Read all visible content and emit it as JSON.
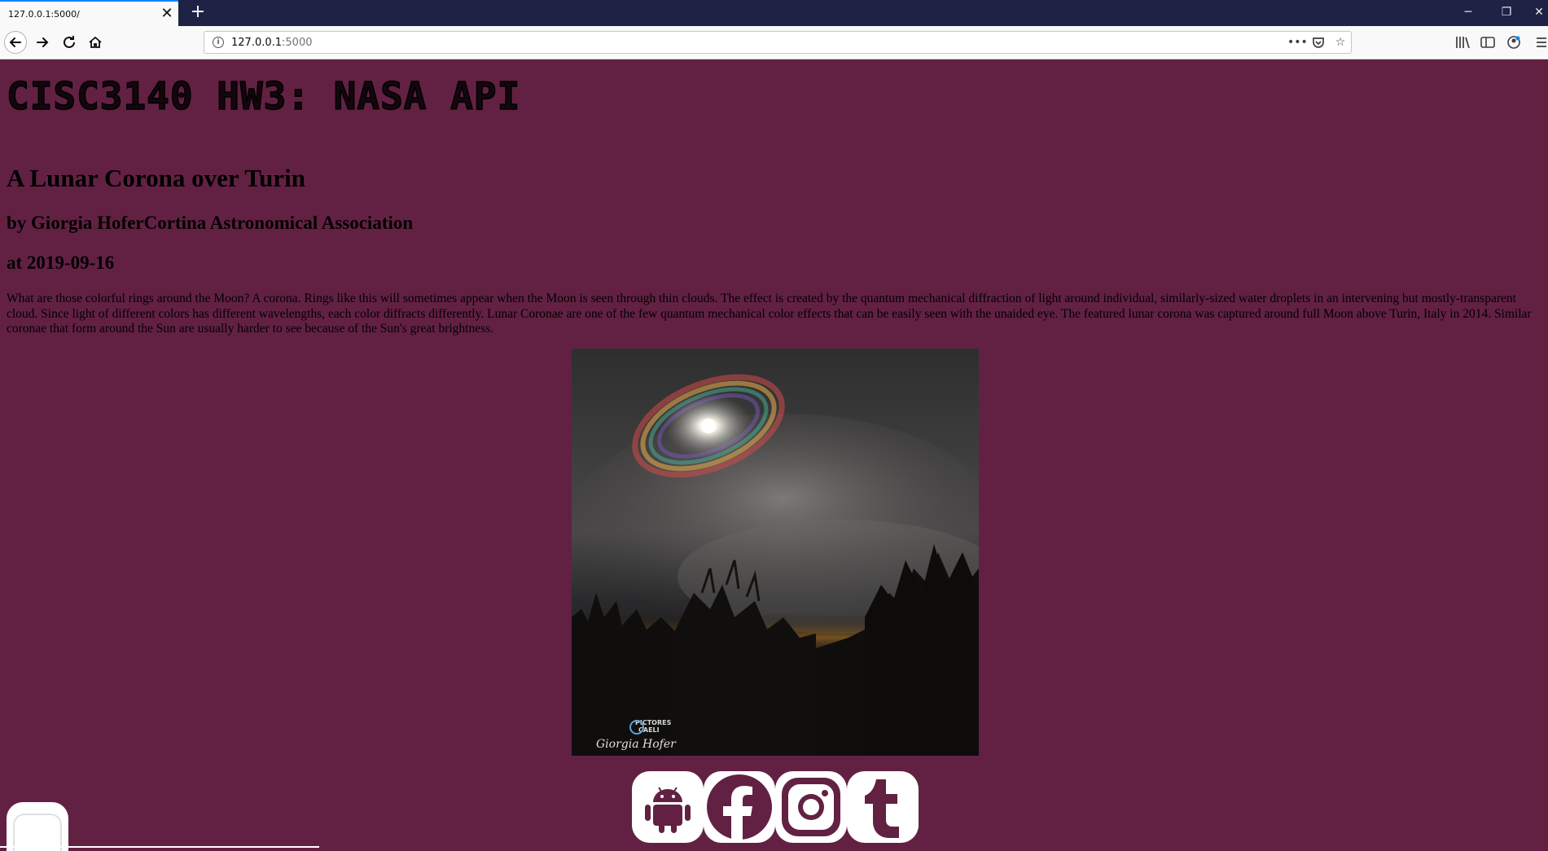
{
  "browser": {
    "tab_title": "127.0.0.1:5000/",
    "tab_close": "✕",
    "new_tab": "+",
    "url_host": "127.0.0.1",
    "url_port": ":5000",
    "icons": [
      "back-icon",
      "forward-icon",
      "reload-icon",
      "home-icon",
      "info-icon",
      "more-icon",
      "pocket-icon",
      "bookmark-star-icon",
      "library-icon",
      "sidebar-icon",
      "account-icon",
      "menu-icon"
    ],
    "window_controls": {
      "minimize": "─",
      "restore": "❐",
      "close": "✕"
    }
  },
  "page": {
    "site_title": "CISC3140 HW3: NASA API",
    "apod_title": "A Lunar Corona over Turin",
    "apod_author": "by Giorgia HoferCortina Astronomical Association",
    "apod_date": "at 2019-09-16",
    "apod_description": "What are those colorful rings around the Moon? A corona. Rings like this will sometimes appear when the Moon is seen through thin clouds. The effect is created by the quantum mechanical diffraction of light around individual, similarly-sized water droplets in an intervening but mostly-transparent cloud. Since light of different colors has different wavelengths, each color diffracts differently. Lunar Coronae are one of the few quantum mechanical color effects that can be easily seen with the unaided eye. The featured lunar corona was captured around full Moon above Turin, Italy in 2014. Similar coronae that form around the Sun are usually harder to see because of the Sun's great brightness.",
    "image_watermark": "PICTORES CAELI Giorgia Hofer",
    "social_icons": [
      "android-icon",
      "facebook-icon",
      "instagram-icon",
      "tumblr-icon"
    ]
  },
  "colors": {
    "page_background": "#622143",
    "icon_color": "#622143",
    "tab_bar": "#1e2245",
    "accent": "#0a84ff"
  }
}
